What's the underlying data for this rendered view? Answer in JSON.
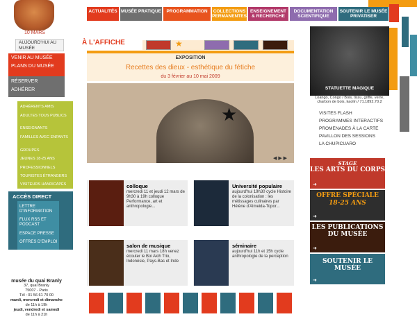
{
  "left": {
    "date": "10 MARS",
    "today": "AUJOURD'HUI AU MUSÉE",
    "red_links": [
      "VENIR AU MUSÉE",
      "PLANS DU MUSÉE"
    ],
    "grey_links": [
      "RÉSERVER",
      "ADHÉRER"
    ],
    "green_links": [
      "ADHÉRENTS AMIS",
      "ADULTES TOUS PUBLICS",
      "ENSEIGNANTS",
      "FAMILLES AVEC ENFANTS",
      "GROUPES",
      "JEUNES 18-25 ANS",
      "PROFESSIONNELS",
      "TOURISTES ÉTRANGERS",
      "VISITEURS HANDICAPÉS"
    ],
    "acces_title": "ACCÈS DIRECT",
    "acces_links": [
      "LETTRE D'INFORMATION",
      "FLUX RSS ET PODCAST",
      "ESPACE PRESSE",
      "OFFRES D'EMPLOI"
    ],
    "address": {
      "name": "musée du quai Branly",
      "street": "37, quai Branly",
      "city": "75007 - Paris",
      "tel": "Tél : 01 56 61 70 00",
      "hours1": "mardi, mercredi et dimanche",
      "hours1b": "de 11h à 19h",
      "hours2": "jeudi, vendredi et samedi",
      "hours2b": "de 11h à 21h"
    }
  },
  "nav": {
    "items": [
      {
        "label": "ACTUALITÉS",
        "color": "#e23b1e"
      },
      {
        "label": "MUSÉE PRATIQUE",
        "color": "#6f6f6f"
      },
      {
        "label": "PROGRAMMATION",
        "color": "#e8541e"
      },
      {
        "label": "COLLECTIONS PERMANENTES",
        "color": "#f39c12"
      },
      {
        "label": "ENSEIGNEMENT & RECHERCHE",
        "color": "#b23a6a"
      },
      {
        "label": "DOCUMENTATION SCIENTIFIQUE",
        "color": "#8e6cae"
      },
      {
        "label": "SOUTENIR LE MUSÉE PRIVATISER",
        "color": "#2f6c7e"
      }
    ]
  },
  "affiche": {
    "title": "À L'AFFICHE",
    "exposition_label": "EXPOSITION",
    "expo_title": "Recettes des dieux - esthétique du fétiche",
    "expo_dates": "du 3 février au 10 mai 2009",
    "nav_arrows": "◀ ▶ ▶"
  },
  "news": [
    {
      "title": "colloque",
      "text": "mercredi 11 et jeudi 12 mars de 9h30 à 19h colloque Performance, art et anthropologie..."
    },
    {
      "title": "Université populaire",
      "text": "aujourd'hui 19h30 cycle Histoire de la colonisation : les métissages culinaires par Hélène d'Almeida-Topor..."
    },
    {
      "title": "salon de musique",
      "text": "mercredi 11 mars 18h venez écouter le Boi Akih Trio, Indonésie, Pays-Bas et Inde"
    },
    {
      "title": "séminaire",
      "text": "aujourd'hui 11h et 15h cycle anthropologie de la perception"
    }
  ],
  "right": {
    "statuette_title": "STATUETTE MAGIQUE",
    "statuette_caption": "Loango, Congo / Bois, tissu, griffe, verre, charbon de bois, kaolin / 71.1892.70.2",
    "links": [
      "VISITES FLASH",
      "PROGRAMMES INTERACTIFS",
      "PROMENADES À LA CARTE",
      "PAVILLON DES SESSIONS",
      "LA CHUPICUARO"
    ],
    "promos": [
      {
        "line1": "STAGE",
        "line2": "LES ARTS DU CORPS"
      },
      {
        "line1": "OFFRE SPÉCIALE",
        "line2": "18-25 ANS"
      },
      {
        "line1": "LES PUBLICATIONS",
        "line2": "DU MUSÉE"
      },
      {
        "line1": "SOUTENIR LE MUSÉE",
        "line2": ""
      }
    ]
  }
}
